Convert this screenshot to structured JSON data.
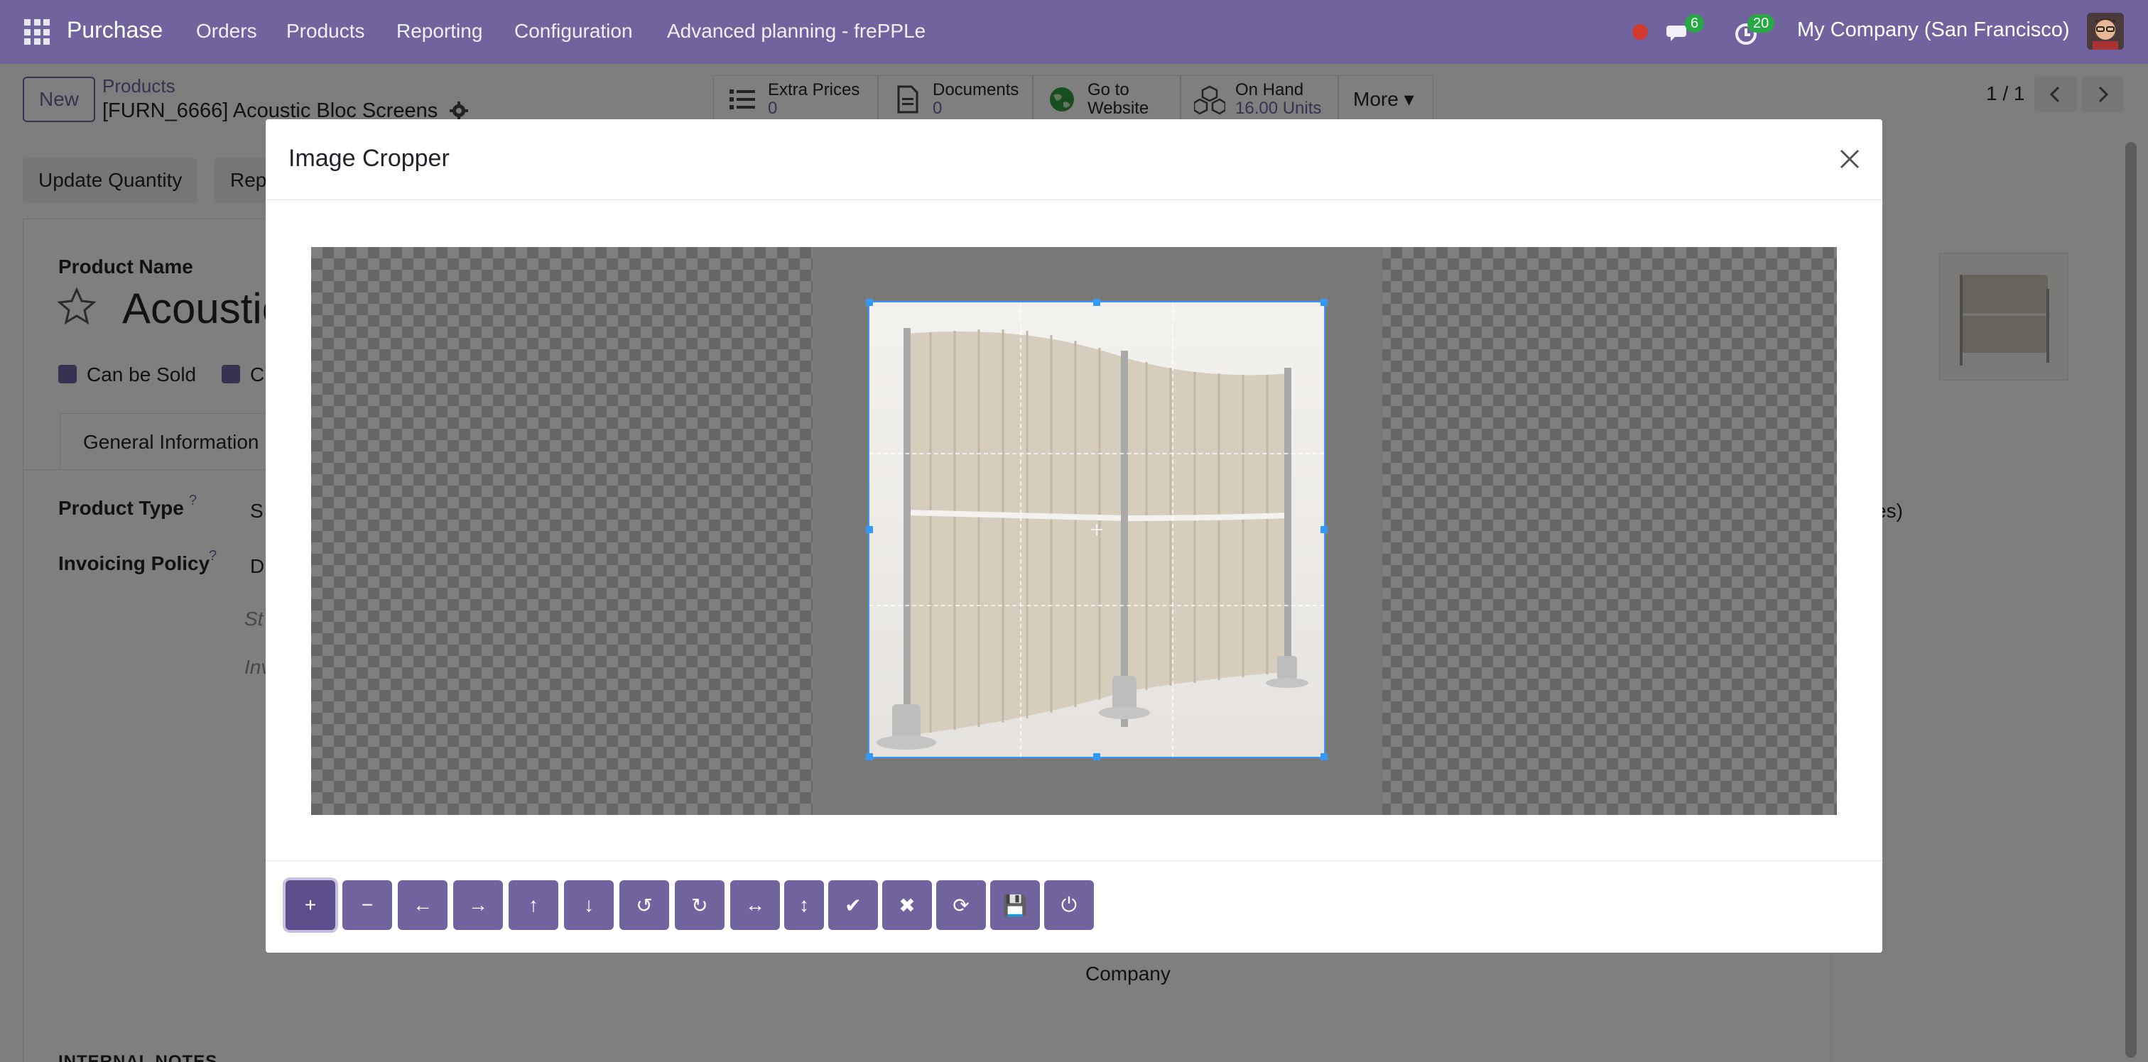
{
  "navbar": {
    "app_name": "Purchase",
    "menu": [
      "Orders",
      "Products",
      "Reporting",
      "Configuration",
      "Advanced planning - frePPLe"
    ],
    "chat_count": "6",
    "activity_count": "20",
    "company": "My Company (San Francisco)"
  },
  "control_panel": {
    "new_label": "New",
    "breadcrumb_parent": "Products",
    "breadcrumb_current": "[FURN_6666] Acoustic Bloc Screens",
    "smart_buttons": [
      {
        "label": "Extra Prices",
        "value": "0",
        "icon": "list-icon"
      },
      {
        "label": "Documents",
        "value": "0",
        "icon": "document-icon"
      },
      {
        "label": "Go to",
        "value": "Website",
        "icon": "globe-icon"
      },
      {
        "label": "On Hand",
        "value": "16.00 Units",
        "icon": "cubes-icon"
      }
    ],
    "more_label": "More ▾",
    "pager": "1 / 1"
  },
  "form": {
    "update_qty_label": "Update Quantity",
    "rep_label": "Rep",
    "product_name_label": "Product Name",
    "product_name_value": "Acoustic",
    "can_be_sold": "Can be Sold",
    "can_be_purchased_short": "C",
    "tab_general": "General Information",
    "product_type_label": "Product Type",
    "product_type_value": "S",
    "invoicing_policy_label": "Invoicing Policy",
    "invoicing_policy_value": "D",
    "help_1": "St",
    "help_2": "Inv",
    "help_mark": "?",
    "taxes_fragment": "xes)",
    "company_label": "Company",
    "internal_notes": "INTERNAL NOTES"
  },
  "modal": {
    "title": "Image Cropper"
  },
  "toolbar": [
    {
      "name": "zoom-in-button",
      "icon": "zoom-in-icon",
      "glyph": "+"
    },
    {
      "name": "zoom-out-button",
      "icon": "zoom-out-icon",
      "glyph": "−"
    },
    {
      "name": "move-left-button",
      "icon": "arrow-left-icon",
      "glyph": "←"
    },
    {
      "name": "move-right-button",
      "icon": "arrow-right-icon",
      "glyph": "→"
    },
    {
      "name": "move-up-button",
      "icon": "arrow-up-icon",
      "glyph": "↑"
    },
    {
      "name": "move-down-button",
      "icon": "arrow-down-icon",
      "glyph": "↓"
    },
    {
      "name": "rotate-left-button",
      "icon": "rotate-left-icon",
      "glyph": "↺"
    },
    {
      "name": "rotate-right-button",
      "icon": "rotate-right-icon",
      "glyph": "↻"
    },
    {
      "name": "flip-horizontal-button",
      "icon": "flip-horizontal-icon",
      "glyph": "↔"
    },
    {
      "name": "flip-vertical-button",
      "icon": "flip-vertical-icon",
      "glyph": "↕"
    },
    {
      "name": "crop-confirm-button",
      "icon": "check-icon",
      "glyph": "✔"
    },
    {
      "name": "crop-clear-button",
      "icon": "times-icon",
      "glyph": "✖"
    },
    {
      "name": "reset-button",
      "icon": "refresh-icon",
      "glyph": "⟳"
    },
    {
      "name": "save-button",
      "icon": "save-icon",
      "glyph": "💾"
    },
    {
      "name": "power-button",
      "icon": "power-icon",
      "glyph": "⏻"
    }
  ],
  "colors": {
    "primary": "#71639e",
    "crop_outline": "#3399ff",
    "badge": "#28a745",
    "record_dot": "#d23a2f"
  }
}
